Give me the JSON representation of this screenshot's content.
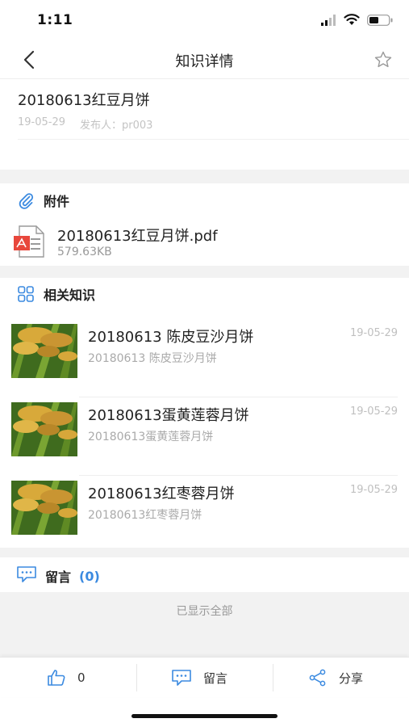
{
  "status_bar": {
    "time": "1:11"
  },
  "nav": {
    "title": "知识详情"
  },
  "article": {
    "title": "20180613红豆月饼",
    "date": "19-05-29",
    "publisher": "发布人：pr003"
  },
  "attachments": {
    "heading": "附件",
    "file": {
      "name": "20180613红豆月饼.pdf",
      "size": "579.63KB"
    }
  },
  "related": {
    "heading": "相关知识",
    "items": [
      {
        "title": "20180613 陈皮豆沙月饼",
        "subtitle": "20180613 陈皮豆沙月饼",
        "date": "19-05-29"
      },
      {
        "title": "20180613蛋黄莲蓉月饼",
        "subtitle": "20180613蛋黄莲蓉月饼",
        "date": "19-05-29"
      },
      {
        "title": "20180613红枣蓉月饼",
        "subtitle": "20180613红枣蓉月饼",
        "date": "19-05-29"
      }
    ]
  },
  "comments": {
    "heading": "留言",
    "count": "(0)",
    "all_shown": "已显示全部"
  },
  "toolbar": {
    "like_count": "0",
    "comment_label": "留言",
    "share_label": "分享"
  },
  "colors": {
    "accent": "#3b8ae0",
    "pdf_red": "#e8473c",
    "background_gray": "#f2f2f2"
  },
  "icons": [
    "back-icon",
    "star-icon",
    "paperclip-icon",
    "pdf-icon",
    "grid-icon",
    "comment-icon",
    "thumbs-up-icon",
    "share-icon"
  ]
}
